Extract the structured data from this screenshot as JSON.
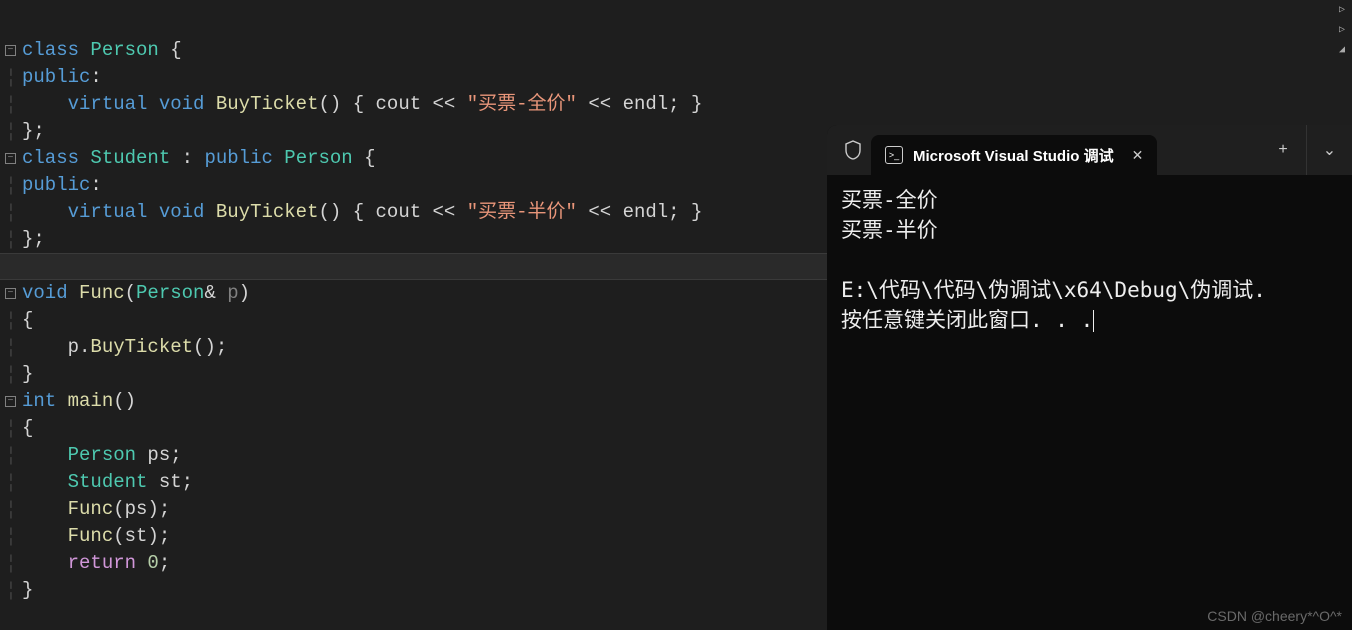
{
  "code": {
    "l1": {
      "cls": "class",
      "nm": "Person",
      "brace": " {"
    },
    "l2": {
      "kw": "public",
      "colon": ":"
    },
    "l3": {
      "virt": "virtual",
      "vd": "void",
      "fn": "BuyTicket",
      "paren": "()",
      "obrace": " { ",
      "cout": "cout",
      "op1": " << ",
      "str": "\"买票-全价\"",
      "op2": " << ",
      "endl": "endl",
      "semi": "; }"
    },
    "l4": {
      "close": "};"
    },
    "l5": {
      "cls": "class",
      "nm": "Student",
      "inh": " : ",
      "acc": "public",
      "base": " Person",
      "brace": " {"
    },
    "l6": {
      "kw": "public",
      "colon": ":"
    },
    "l7": {
      "virt": "virtual",
      "vd": "void",
      "fn": "BuyTicket",
      "paren": "()",
      "obrace": " { ",
      "cout": "cout",
      "op1": " << ",
      "str": "\"买票-半价\"",
      "op2": " << ",
      "endl": "endl",
      "semi": "; }"
    },
    "l8": {
      "close": "};"
    },
    "l10": {
      "vd": "void",
      "fn": "Func",
      "open": "(",
      "typ": "Person",
      "amp": "& ",
      "par": "p",
      "close": ")"
    },
    "l11": {
      "open": "{"
    },
    "l12": {
      "obj": "p",
      "dot": ".",
      "call": "BuyTicket",
      "paren": "();"
    },
    "l13": {
      "close": "}"
    },
    "l14": {
      "typ": "int",
      "fn": "main",
      "paren": "()"
    },
    "l15": {
      "open": "{"
    },
    "l16": {
      "typ": "Person",
      "var": " ps",
      "semi": ";"
    },
    "l17": {
      "typ": "Student",
      "var": " st",
      "semi": ";"
    },
    "l18": {
      "fn": "Func",
      "open": "(",
      "arg": "ps",
      "close": ");"
    },
    "l19": {
      "fn": "Func",
      "open": "(",
      "arg": "st",
      "close": ");"
    },
    "l20": {
      "ret": "return",
      "val": " 0",
      "semi": ";"
    },
    "l21": {
      "close": "}"
    }
  },
  "console": {
    "tab_title": "Microsoft Visual Studio 调试",
    "out_line1": "买票-全价",
    "out_line2": "买票-半价",
    "out_line3": "",
    "out_line4": "E:\\代码\\代码\\伪调试\\x64\\Debug\\伪调试.",
    "out_line5": "按任意键关闭此窗口. . ."
  },
  "watermark": "CSDN @cheery*^O^*",
  "icons": {
    "shield": "shield",
    "cmd": ">_",
    "close": "✕",
    "plus": "+",
    "chevron": "⌄",
    "fold": "−",
    "tri": "▷"
  }
}
